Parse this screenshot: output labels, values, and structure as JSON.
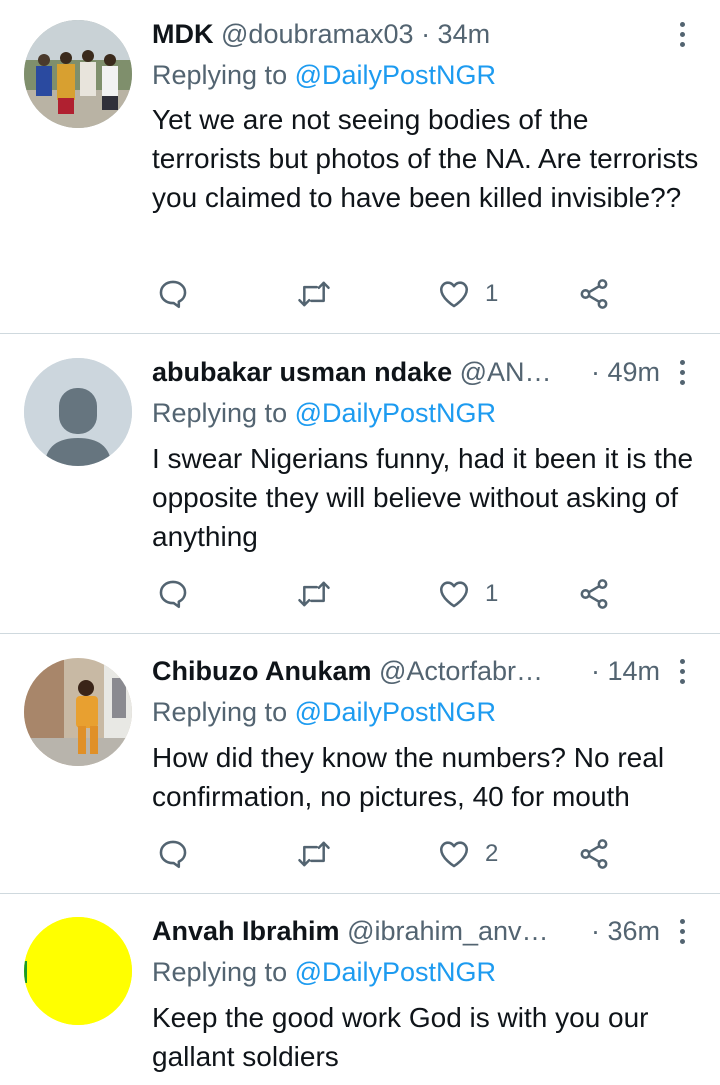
{
  "tweets": [
    {
      "name": "MDK",
      "handle": "@doubramax03",
      "time": "· 34m",
      "replying_prefix": "Replying to",
      "replying_to": "@DailyPostNGR",
      "text": "Yet we are not seeing bodies of the terrorists but photos of the NA. Are terrorists you claimed to have been killed invisible??",
      "reply_count": "",
      "retweet_count": "",
      "like_count": "1"
    },
    {
      "name": "abubakar usman ndake",
      "handle": "@AN…",
      "time": "· 49m",
      "replying_prefix": "Replying to",
      "replying_to": "@DailyPostNGR",
      "text": "I swear Nigerians funny, had it been it is the opposite they will believe without asking of anything",
      "reply_count": "",
      "retweet_count": "",
      "like_count": "1"
    },
    {
      "name": "Chibuzo Anukam",
      "handle": "@Actorfabr…",
      "time": "· 14m",
      "replying_prefix": "Replying to",
      "replying_to": "@DailyPostNGR",
      "text": "How did they know the numbers? No real confirmation, no pictures, 40 for mouth",
      "reply_count": "",
      "retweet_count": "",
      "like_count": "2"
    },
    {
      "name": "Anvah Ibrahim",
      "handle": "@ibrahim_anv…",
      "time": "· 36m",
      "replying_prefix": "Replying to",
      "replying_to": "@DailyPostNGR",
      "text": "Keep the good work God is with you our gallant soldiers"
    }
  ],
  "colors": {
    "accent": "#1d9bf0",
    "secondary_text": "#536471",
    "divider": "#cfd9de",
    "default_avatar_bg": "#ccd6dd",
    "default_avatar_fg": "#66757f",
    "yellow_avatar": "#ffff00"
  },
  "icons": [
    "reply-icon",
    "retweet-icon",
    "like-icon",
    "share-icon",
    "more-icon"
  ]
}
